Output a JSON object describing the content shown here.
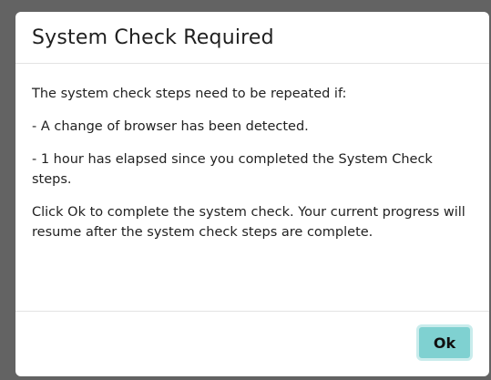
{
  "dialog": {
    "title": "System Check Required",
    "paragraphs": [
      "The system check steps need to be repeated if:",
      "- A change of browser has been detected.",
      "- 1 hour has elapsed since you completed the System Check steps.",
      "Click Ok to complete the system check. Your current progress will resume after the system check steps are complete."
    ],
    "ok_label": "Ok"
  },
  "colors": {
    "backdrop": "#636363",
    "dialog_background": "#ffffff",
    "ok_button": "#7fd1d1",
    "ok_button_border": "#c9ecec"
  }
}
